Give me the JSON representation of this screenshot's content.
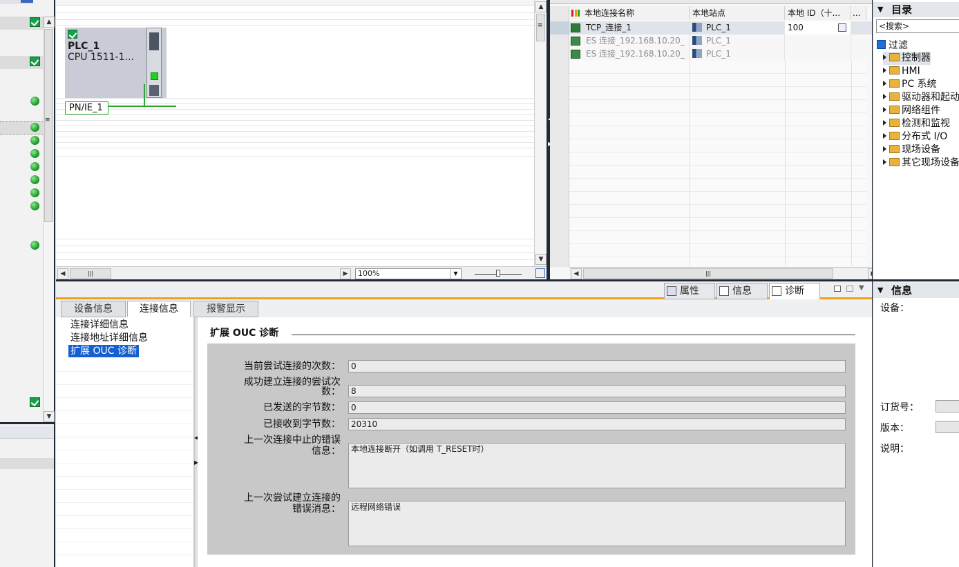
{
  "device_view": {
    "plc_name": "PLC_1",
    "plc_cpu": "CPU 1511-1...",
    "network_label": "PN/IE_1",
    "zoom": "100%"
  },
  "connections_table": {
    "headers": [
      "本地连接名称",
      "本地站点",
      "本地 ID（十...",
      "..."
    ],
    "rows": [
      {
        "name": "TCP_连接_1",
        "station": "PLC_1",
        "id": "100",
        "active": true
      },
      {
        "name": "ES 连接_192.168.10.20_",
        "station": "PLC_1",
        "id": "",
        "active": false
      },
      {
        "name": "ES 连接_192.168.10.20_",
        "station": "PLC_1",
        "id": "",
        "active": false
      }
    ]
  },
  "catalog": {
    "title": "目录",
    "search_placeholder": "<搜索>",
    "filter_label": "过滤",
    "items": [
      "控制器",
      "HMI",
      "PC 系统",
      "驱动器和起动",
      "网络组件",
      "检测和监视",
      "分布式 I/O",
      "现场设备",
      "其它现场设备"
    ]
  },
  "inspector_tabs": {
    "properties": "属性",
    "info": "信息",
    "diagnostics": "诊断"
  },
  "diag_tabs": [
    "设备信息",
    "连接信息",
    "报警显示"
  ],
  "nav": {
    "items": [
      "连接详细信息",
      "连接地址详细信息",
      "扩展 OUC 诊断"
    ]
  },
  "ouc": {
    "title": "扩展 OUC 诊断",
    "fields": [
      {
        "label": "当前尝试连接的次数：",
        "value": "0"
      },
      {
        "label_line1": "成功建立连接的尝试次",
        "label_line2": "数：",
        "value": "8"
      },
      {
        "label": "已发送的字节数：",
        "value": "0"
      },
      {
        "label": "已接收到字节数：",
        "value": "20310"
      },
      {
        "label_line1": "上一次连接中止的错误",
        "label_line2": "信息：",
        "value": "本地连接断开（如调用 T_RESET时）"
      },
      {
        "label_line1": "上一次尝试建立连接的",
        "label_line2": "错误消息：",
        "value": "远程网络错误"
      }
    ]
  },
  "info_panel": {
    "title": "信息",
    "device_label": "设备：",
    "order_label": "订货号：",
    "version_label": "版本：",
    "desc_label": "说明："
  },
  "colors": {
    "accent_orange": "#f0a01e",
    "selection_blue": "#1560d0",
    "status_green": "#18a04a",
    "frame_dark": "#1e2a36"
  }
}
